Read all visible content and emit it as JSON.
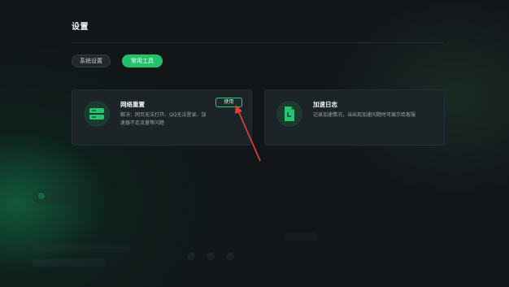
{
  "settings": {
    "title": "设置",
    "tabs": [
      {
        "label": "系统设置",
        "active": false
      },
      {
        "label": "常用工具",
        "active": true
      }
    ],
    "tools": [
      {
        "title": "网络重置",
        "description": "解决：网页无法打开、QQ无法登录、加速器不走流量等问题",
        "button_label": "使用",
        "icon": "server-icon"
      },
      {
        "title": "加速日志",
        "description": "记录加速情况，当出现加速问题时可展示给客服",
        "icon": "document-icon"
      }
    ]
  },
  "colors": {
    "accent": "#21c26a",
    "annotation_arrow": "#e0403a",
    "background": "#121619",
    "card": "#1c2428"
  }
}
